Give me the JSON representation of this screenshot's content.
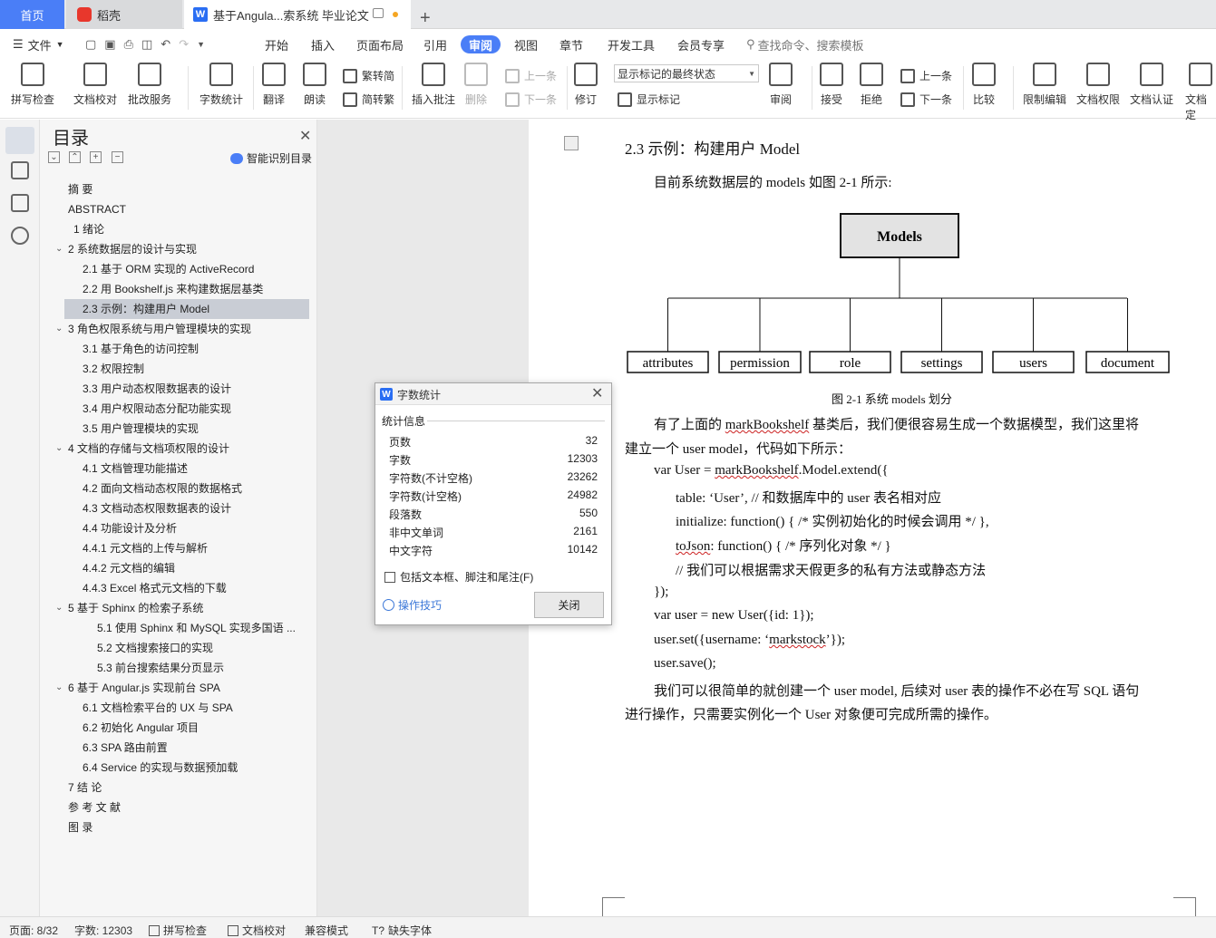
{
  "tabs": {
    "home": "首页",
    "daoke": "稻壳",
    "doc": "基于Angula...索系统 毕业论文",
    "add": "+"
  },
  "menu": {
    "file": "文件",
    "items": [
      "开始",
      "插入",
      "页面布局",
      "引用",
      "审阅",
      "视图",
      "章节",
      "开发工具",
      "会员专享"
    ],
    "search": "查找命令、搜索模板"
  },
  "ribbon": {
    "spell": "拼写检查",
    "proof": "文档校对",
    "batch": "批改服务",
    "wordcount": "字数统计",
    "translate": "翻译",
    "read": "朗读",
    "t2s": "繁转简",
    "s2t": "简转繁",
    "insert_comment": "插入批注",
    "delete": "删除",
    "prev_c": "上一条",
    "next_c": "下一条",
    "revise": "修订",
    "track_state": "显示标记的最终状态",
    "show_marks": "显示标记",
    "review": "审阅",
    "accept": "接受",
    "reject": "拒绝",
    "prev": "上一条",
    "next": "下一条",
    "compare": "比较",
    "restrict": "限制编辑",
    "perm": "文档权限",
    "cert": "文档认证",
    "final": "文档定"
  },
  "toc": {
    "title": "目录",
    "smart": "智能识别目录",
    "items": [
      "摘  要",
      "ABSTRACT",
      "1  绪论",
      "2  系统数据层的设计与实现",
      "2.1  基于 ORM 实现的 ActiveRecord",
      "2.2  用 Bookshelf.js 来构建数据层基类",
      "2.3  示例：构建用户  Model",
      "3  角色权限系统与用户管理模块的实现",
      "3.1  基于角色的访问控制",
      "3.2  权限控制",
      "3.3  用户动态权限数据表的设计",
      "3.4  用户权限动态分配功能实现",
      "3.5  用户管理模块的实现",
      "4  文档的存储与文档项权限的设计",
      "4.1  文档管理功能描述",
      "4.2  面向文档动态权限的数据格式",
      "4.3  文档动态权限数据表的设计",
      "4.4 功能设计及分析",
      "4.4.1  元文档的上传与解析",
      "4.4.2  元文档的编辑",
      "4.4.3 Excel 格式元文档的下载",
      "5  基于 Sphinx 的检索子系统",
      "5.1  使用 Sphinx 和 MySQL 实现多国语 ...",
      "5.2  文档搜索接口的实现",
      "5.3  前台搜索结果分页显示",
      "6  基于 Angular.js  实现前台 SPA",
      "6.1  文档检索平台的  UX  与  SPA",
      "6.2  初始化  Angular  项目",
      "6.3 SPA 路由前置",
      "6.4 Service 的实现与数据预加载",
      "7 结  论",
      "参  考  文  献",
      "图  录"
    ]
  },
  "doc": {
    "heading": "2.3  示例：构建用户  Model",
    "p1": "目前系统数据层的 models 如图 2-1 所示:",
    "diagram": {
      "root": "Models",
      "children": [
        "attributes",
        "permission",
        "role",
        "settings",
        "users",
        "document"
      ]
    },
    "caption": "图 2-1  系统 models 划分",
    "p2a": "有了上面的 ",
    "p2b": "markBookshelf",
    "p2c": " 基类后，我们便很容易生成一个数据模型，我们这里将",
    "p2d": "建立一个 user model，代码如下所示：",
    "c1a": "var User = ",
    "c1b": "markBookshelf",
    ".": "",
    "c1c": ".Model.extend({",
    "c2": "table: ‘User’, //  和数据库中的 user 表名相对应",
    "c3": "initialize: function() { /*  实例初始化的时候会调用  */ },",
    "c4a": "toJson",
    "c4b": ": function() { /*  序列化对象  */ }",
    "c5": "//  我们可以根据需求天假更多的私有方法或静态方法",
    "c6": "});",
    "c7": "var user = new User({id: 1});",
    "c8a": "user.set({username:  ‘",
    "c8b": "markstock",
    "c8c": "’});",
    "c9": "user.save();",
    "p3a": "我们可以很简单的就创建一个 user model, 后续对 user 表的操作不必在写 SQL 语句",
    "p3b": "进行操作，只需要实例化一个 User 对象便可完成所需的操作。"
  },
  "dialog": {
    "title": "字数统计",
    "section": "统计信息",
    "rows": [
      [
        "页数",
        "32"
      ],
      [
        "字数",
        "12303"
      ],
      [
        "字符数(不计空格)",
        "23262"
      ],
      [
        "字符数(计空格)",
        "24982"
      ],
      [
        "段落数",
        "550"
      ],
      [
        "非中文单词",
        "2161"
      ],
      [
        "中文字符",
        "10142"
      ]
    ],
    "checkbox": "包括文本框、脚注和尾注(F)",
    "tips": "操作技巧",
    "close": "关闭"
  },
  "status": {
    "page": "页面: 8/32",
    "words": "字数: 12303",
    "spell": "拼写检查",
    "proof": "文档校对",
    "compat": "兼容模式",
    "font": "缺失字体"
  }
}
